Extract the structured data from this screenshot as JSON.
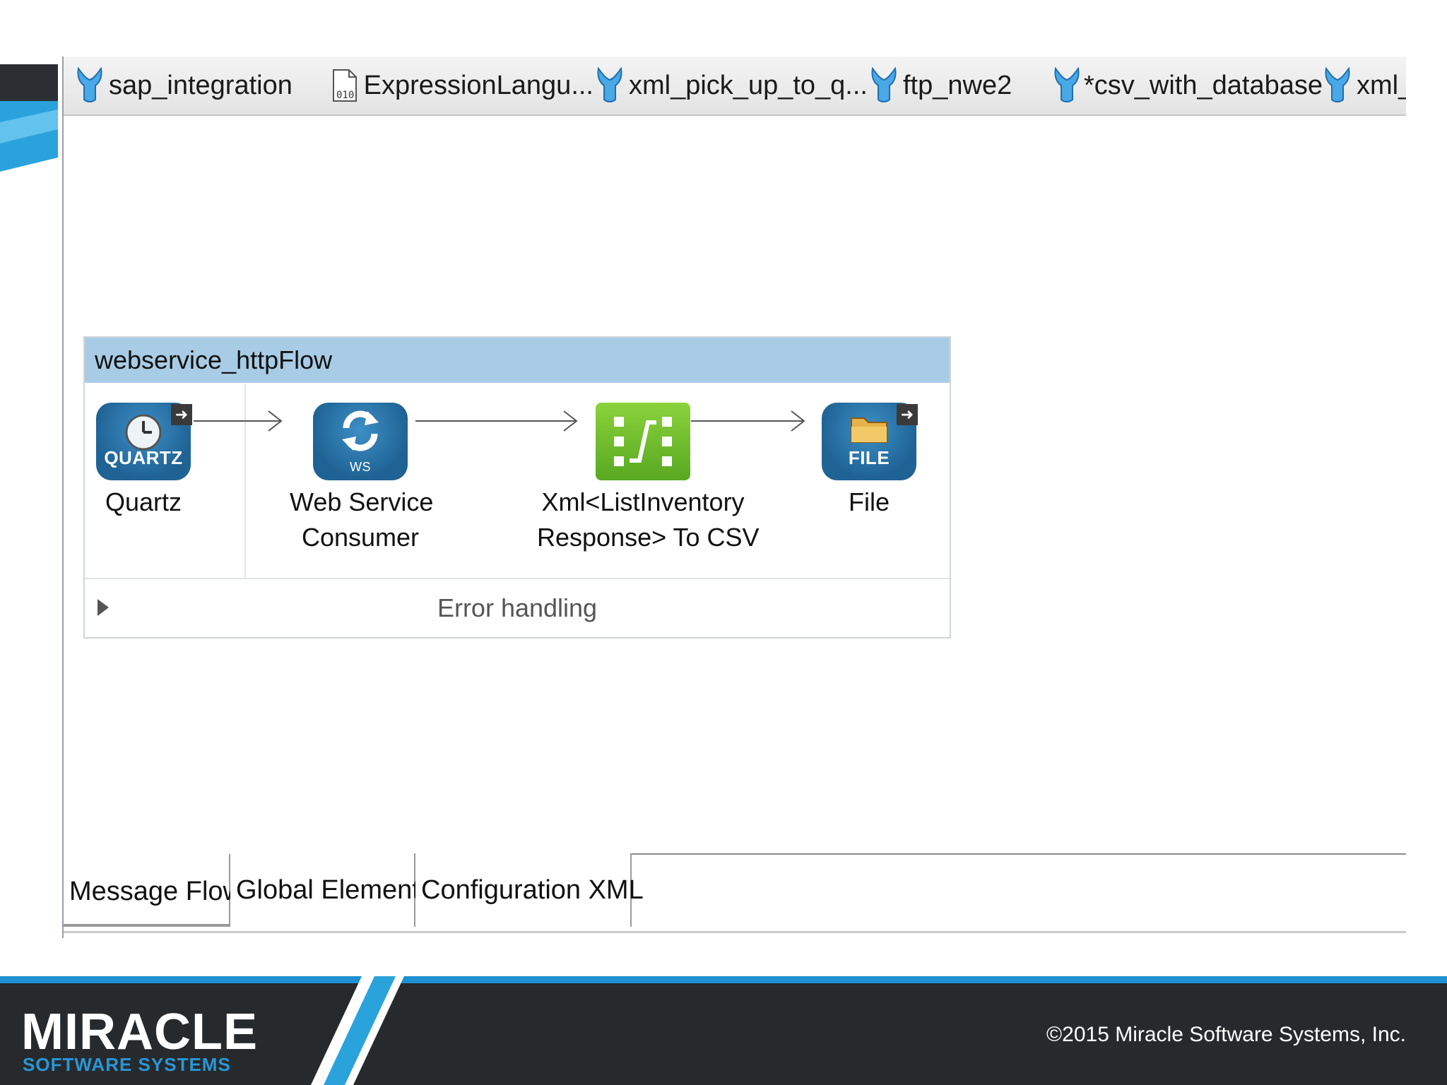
{
  "editor_tabs": [
    {
      "label": "sap_integration",
      "icon": "mule-icon"
    },
    {
      "label": "ExpressionLangu...",
      "icon": "binary-file-icon"
    },
    {
      "label": "xml_pick_up_to_q...",
      "icon": "mule-icon"
    },
    {
      "label": "ftp_nwe2",
      "icon": "mule-icon"
    },
    {
      "label": "*csv_with_database",
      "icon": "mule-icon"
    },
    {
      "label": "xml_p",
      "icon": "mule-icon"
    }
  ],
  "flow": {
    "name": "webservice_httpFlow",
    "nodes": [
      {
        "icon_caption": "QUARTZ",
        "label_lines": [
          "Quartz"
        ],
        "color": "#1f6394"
      },
      {
        "icon_caption": "WS",
        "label_lines": [
          "Web Service",
          "Consumer"
        ],
        "color": "#1f6394"
      },
      {
        "icon_caption": "",
        "label_lines": [
          "Xml<ListInventory",
          "Response> To CSV"
        ],
        "color": "#58a821"
      },
      {
        "icon_caption": "FILE",
        "label_lines": [
          "File"
        ],
        "color": "#1f6394"
      }
    ],
    "error_handling": "Error handling"
  },
  "bottom_tabs": [
    "Message Flow",
    "Global Elements",
    "Configuration XML"
  ],
  "footer": {
    "logo_main": "MIRACLE",
    "logo_sub": "SOFTWARE SYSTEMS",
    "copyright": "©2015 Miracle Software Systems, Inc."
  },
  "colors": {
    "flow_header": "#a8cce6",
    "footer_bg": "#262a2d",
    "accent_blue": "#1e8fd0"
  }
}
